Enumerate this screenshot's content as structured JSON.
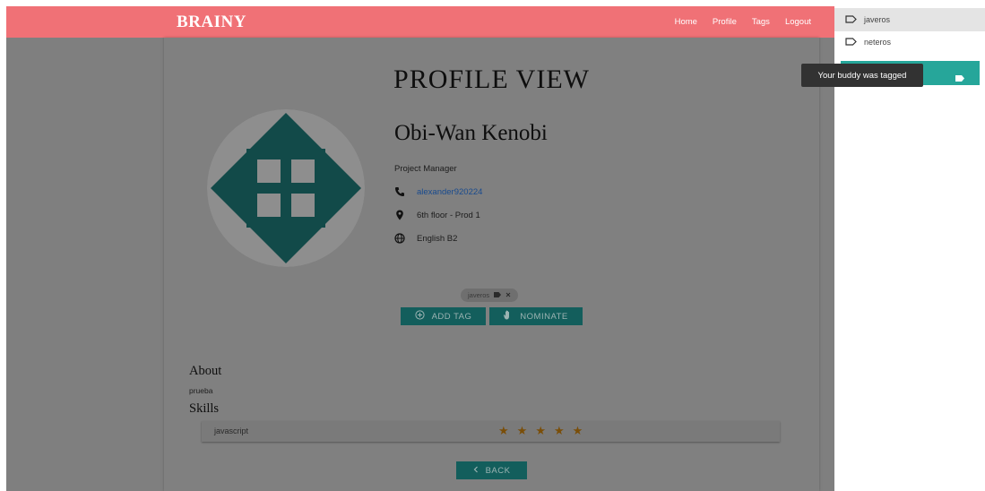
{
  "app": {
    "brand": "BRAINY"
  },
  "nav": {
    "links": [
      "Home",
      "Profile",
      "Tags",
      "Logout"
    ]
  },
  "profile": {
    "page_title": "PROFILE VIEW",
    "name": "Obi-Wan Kenobi",
    "role": "Project Manager",
    "phone": "alexander920224",
    "location": "6th floor - Prod 1",
    "language": "English B2",
    "tags": [
      {
        "label": "javeros"
      }
    ],
    "buttons": {
      "add_tag": "ADD TAG",
      "nominate": "NOMINATE",
      "back": "BACK"
    },
    "about_heading": "About",
    "about_text": "prueba",
    "skills_heading": "Skills",
    "skills": [
      {
        "name": "javascript",
        "rating": 5,
        "max": 5
      }
    ]
  },
  "tag_panel": {
    "items": [
      {
        "label": "javeros",
        "active": true
      },
      {
        "label": "neteros",
        "active": false
      }
    ]
  },
  "toast": {
    "text": "Your buddy was tagged"
  },
  "colors": {
    "navbar": "#f07176",
    "accent": "#26a69a",
    "button_dimmed": "#135e5c",
    "star": "#7a4e08",
    "overlay": "#7f7f7f",
    "toast": "#323232"
  },
  "icons": [
    "phone-icon",
    "location-pin-icon",
    "globe-icon",
    "add-circle-icon",
    "hand-icon",
    "chevron-left-icon",
    "label-icon",
    "star-icon",
    "close-icon"
  ]
}
